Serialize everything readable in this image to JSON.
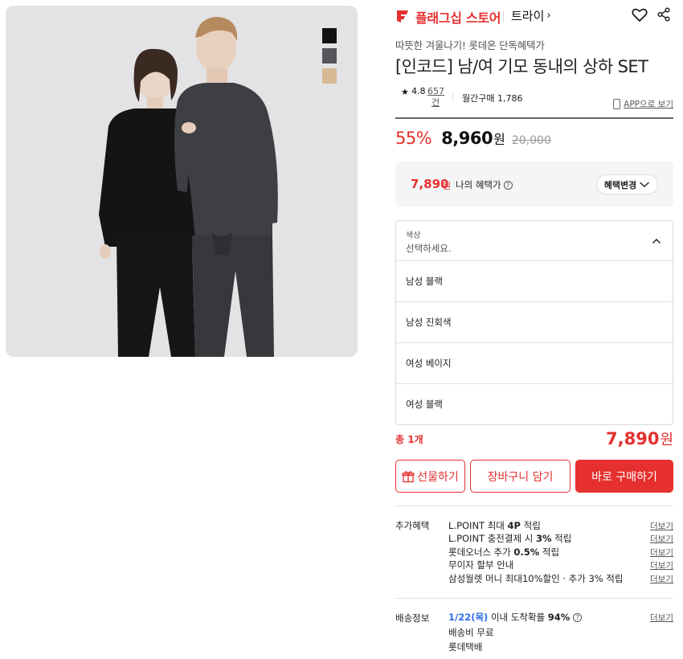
{
  "product_image": {
    "swatches": [
      {
        "name": "black",
        "color": "#111111"
      },
      {
        "name": "charcoal",
        "color": "#55565a"
      },
      {
        "name": "beige",
        "color": "#d9b894"
      }
    ]
  },
  "store": {
    "name": "플래그십 스토어",
    "brand": "트라이",
    "brand_chevron": "›",
    "accent": "#e5302f"
  },
  "product": {
    "subtitle": "따뜻한 겨울나기! 롯데온 단독혜택가",
    "title": "[인코드] 남/여 기모 동내의 상하 SET",
    "rating": "4.8",
    "review_count": "657 건",
    "monthly_purchase": "월간구매 1,786",
    "app_link": "APP으로 보기"
  },
  "price": {
    "discount": "55%",
    "sale": "8,960",
    "won": "원",
    "original": "20,000"
  },
  "benefit": {
    "price": "7,890",
    "won": "원",
    "label": "나의 혜택가",
    "help": "?",
    "change_button": "혜택변경"
  },
  "option": {
    "label": "색상",
    "placeholder": "선택하세요.",
    "items": [
      "남성 블랙",
      "남성 진회색",
      "여성 베이지",
      "여성 블랙"
    ]
  },
  "total": {
    "label": "총 1개",
    "price": "7,890",
    "won": "원"
  },
  "buttons": {
    "gift": "선물하기",
    "cart": "장바구니 담기",
    "buy": "바로 구매하기"
  },
  "extra_benefits": {
    "title": "추가혜택",
    "more": "더보기",
    "lines": [
      {
        "pre": "L.POINT 최대 ",
        "bold": "4P",
        "post": " 적립"
      },
      {
        "pre": "L.POINT 충전결제 시 ",
        "bold": "3%",
        "post": " 적립"
      },
      {
        "pre": "롯데오너스 추가 ",
        "bold": "0.5%",
        "post": " 적립"
      },
      {
        "pre": "무이자 할부 안내",
        "bold": "",
        "post": ""
      },
      {
        "pre": "삼성월렛 머니 최대10%할인 · 추가 3% 적립",
        "bold": "",
        "post": ""
      }
    ]
  },
  "delivery": {
    "title": "배송정보",
    "date": "1/22(목)",
    "arrival": " 이내 도착확률 ",
    "probability": "94%",
    "help": "?",
    "fee": "배송비 무료",
    "carrier": "롯데택배",
    "more": "더보기"
  }
}
